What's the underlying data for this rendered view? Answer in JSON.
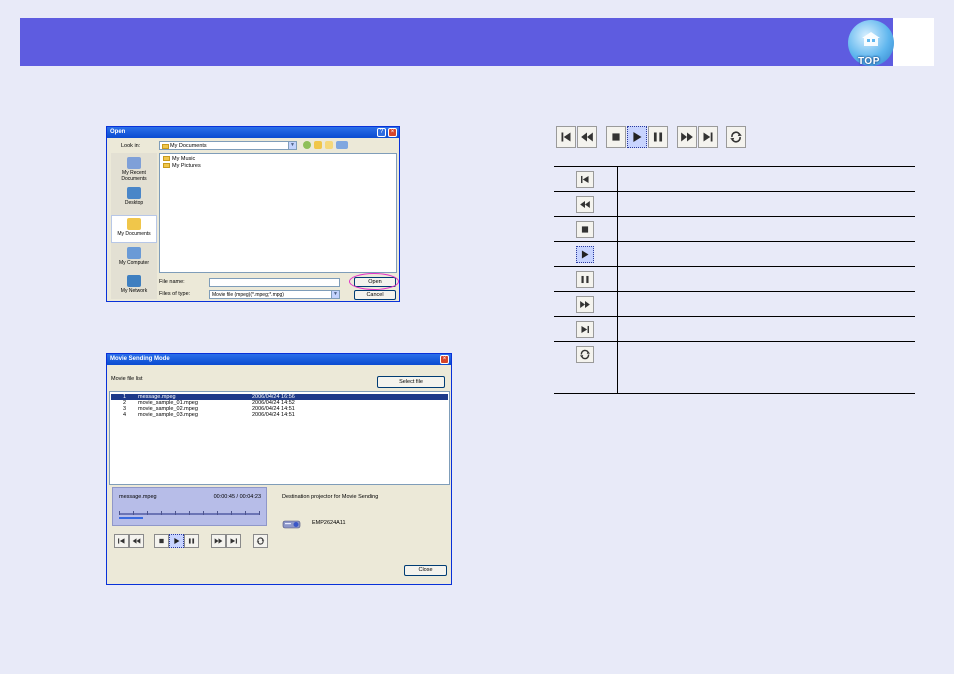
{
  "header": {
    "top_label": "TOP"
  },
  "open_dialog": {
    "title": "Open",
    "look_in_label": "Look in:",
    "look_in_value": "My Documents",
    "places": [
      "My Recent Documents",
      "Desktop",
      "My Documents",
      "My Computer",
      "My Network"
    ],
    "files": [
      "My Music",
      "My Pictures"
    ],
    "file_name_label": "File name:",
    "file_name_value": "",
    "files_of_type_label": "Files of type:",
    "files_of_type_value": "Movie file (mpeg)(*.mpeg;*.mpg)",
    "open_button": "Open",
    "cancel_button": "Cancel"
  },
  "movie_dialog": {
    "title": "Movie Sending Mode",
    "list_label": "Movie file list",
    "select_file_button": "Select file",
    "rows": [
      {
        "num": "1",
        "file": "message.mpeg",
        "date": "2006/04/24 16:56"
      },
      {
        "num": "2",
        "file": "movie_sample_01.mpeg",
        "date": "2006/04/24 14:52"
      },
      {
        "num": "3",
        "file": "movie_sample_02.mpeg",
        "date": "2006/04/24 14:51"
      },
      {
        "num": "4",
        "file": "movie_sample_03.mpeg",
        "date": "2006/04/24 14:51"
      }
    ],
    "player": {
      "current_file": "message.mpeg",
      "time": "00:00:45 / 00:04:23",
      "progress": 0.17
    },
    "destination_label": "Destination projector for Movie Sending",
    "projector_name": "EMP2624A11",
    "close_button": "Close"
  },
  "legend": {
    "rows": [
      {
        "icon": "skip-back-icon",
        "desc": ""
      },
      {
        "icon": "rewind-icon",
        "desc": ""
      },
      {
        "icon": "stop-icon",
        "desc": ""
      },
      {
        "icon": "play-icon",
        "desc": ""
      },
      {
        "icon": "pause-icon",
        "desc": ""
      },
      {
        "icon": "fast-forward-icon",
        "desc": ""
      },
      {
        "icon": "skip-forward-icon",
        "desc": ""
      },
      {
        "icon": "repeat-icon",
        "desc": ""
      }
    ]
  },
  "colors": {
    "header": "#5e5ce0",
    "page_bg": "#e8eaf8",
    "highlight": "#e030c8",
    "selection": "#1d3a8a"
  }
}
